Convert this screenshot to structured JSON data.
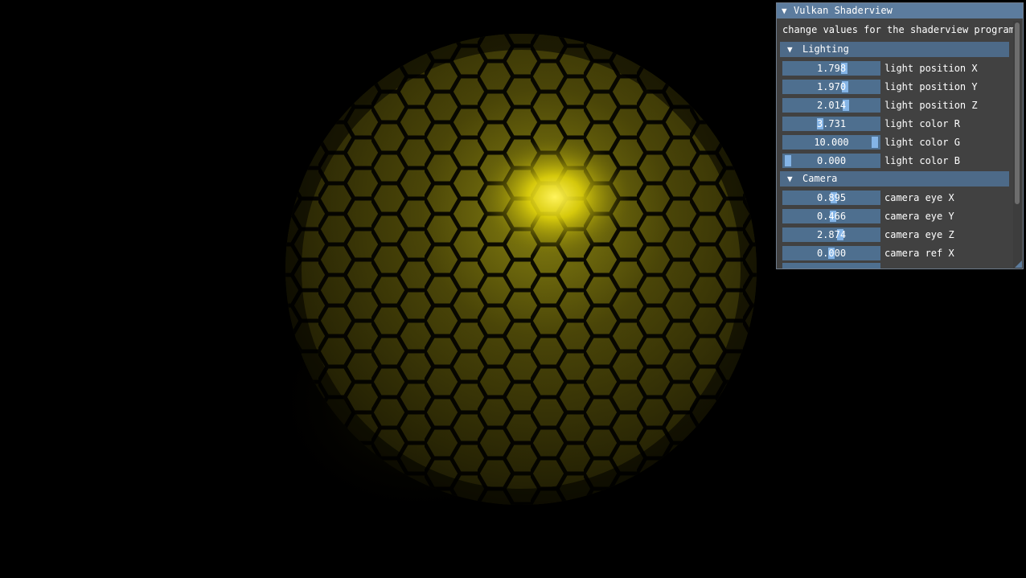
{
  "panel": {
    "title": "Vulkan Shaderview",
    "description": "change values for the shaderview program",
    "sections": {
      "lighting": "Lighting",
      "camera": "Camera"
    },
    "lighting_rows": [
      {
        "value": "1.798",
        "label": "light position X",
        "level": 0.65
      },
      {
        "value": "1.970",
        "label": "light position Y",
        "level": 0.66
      },
      {
        "value": "2.014",
        "label": "light position Z",
        "level": 0.67
      },
      {
        "value": "3.731",
        "label": "light color R",
        "level": 0.37
      },
      {
        "value": "10.000",
        "label": "light color G",
        "level": 1.0
      },
      {
        "value": "0.000",
        "label": "light color B",
        "level": 0.0
      }
    ],
    "camera_rows": [
      {
        "value": "0.895",
        "label": "camera eye X",
        "level": 0.53
      },
      {
        "value": "0.466",
        "label": "camera eye Y",
        "level": 0.52
      },
      {
        "value": "2.874",
        "label": "camera eye Z",
        "level": 0.6
      },
      {
        "value": "0.000",
        "label": "camera ref X",
        "level": 0.5
      }
    ]
  },
  "scene": {
    "object": "hexagon-tiled-sphere",
    "light_color": "#f2e40a",
    "base_color": "#3b3606"
  },
  "colors": {
    "title_bar": "#5c7c9e",
    "section_header": "#4d6a88",
    "slider_bg": "#4e6f8f",
    "slider_grab": "#84b4e6"
  }
}
